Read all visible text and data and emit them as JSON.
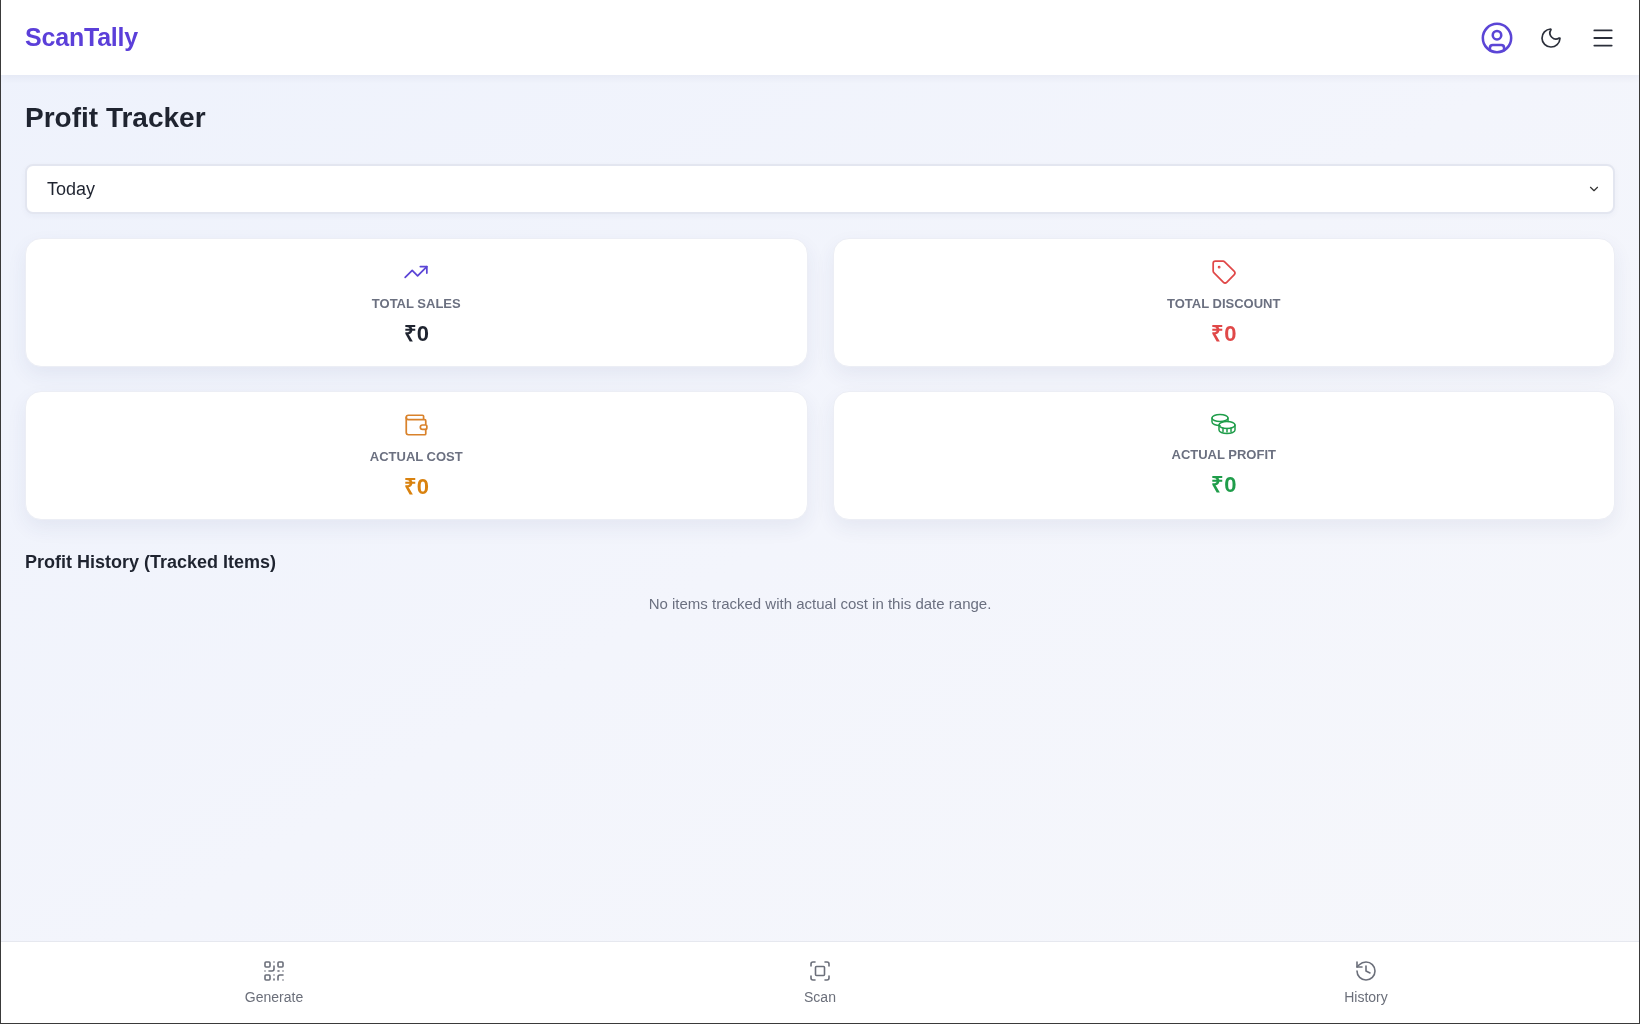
{
  "header": {
    "logo": "ScanTally"
  },
  "page": {
    "title": "Profit Tracker"
  },
  "date_filter": {
    "value": "Today"
  },
  "stats": [
    {
      "kind": "sales",
      "label": "TOTAL SALES",
      "value": "₹0"
    },
    {
      "kind": "discount",
      "label": "TOTAL DISCOUNT",
      "value": "₹0"
    },
    {
      "kind": "cost",
      "label": "ACTUAL COST",
      "value": "₹0"
    },
    {
      "kind": "profit",
      "label": "ACTUAL PROFIT",
      "value": "₹0"
    }
  ],
  "history": {
    "title": "Profit History (Tracked Items)",
    "empty_message": "No items tracked with actual cost in this date range."
  },
  "bottom_nav": [
    {
      "kind": "generate",
      "label": "Generate"
    },
    {
      "kind": "scan",
      "label": "Scan"
    },
    {
      "kind": "history",
      "label": "History"
    }
  ]
}
